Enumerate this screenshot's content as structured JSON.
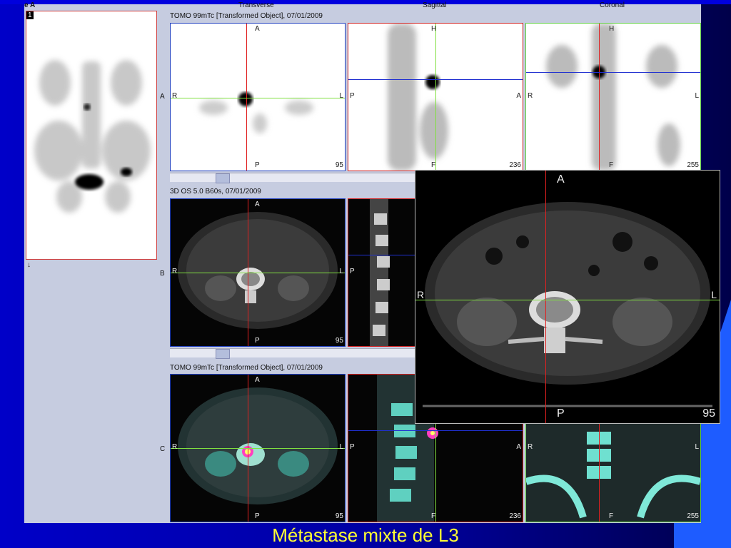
{
  "window": {
    "title": "e A"
  },
  "mip": {
    "number": "1",
    "bottom_mark": "↓"
  },
  "rows": {
    "A": {
      "label": "A",
      "title": "TOMO 99mTc [Transformed Object], 07/01/2009",
      "transverse": {
        "top": "A",
        "left": "R",
        "right": "L",
        "bottom": "P",
        "slice": "95"
      },
      "sagittal": {
        "top": "H",
        "left": "P",
        "right": "A",
        "bottom": "F",
        "slice": "236"
      },
      "coronal": {
        "top": "H",
        "left": "R",
        "right": "L",
        "bottom": "F",
        "slice": "255"
      }
    },
    "B": {
      "label": "B",
      "title": "3D  OS  5.0  B60s, 07/01/2009",
      "transverse": {
        "top": "A",
        "left": "R",
        "right": "L",
        "bottom": "P",
        "slice": "95"
      },
      "sagittal": {
        "left": "P"
      }
    },
    "C": {
      "label": "C",
      "title": "TOMO 99mTc [Transformed Object], 07/01/2009",
      "transverse": {
        "top": "A",
        "left": "R",
        "right": "L",
        "bottom": "P",
        "slice": "95"
      },
      "sagittal": {
        "left": "P",
        "right": "A",
        "bottom": "F",
        "slice": "236"
      },
      "coronal": {
        "left": "R",
        "right": "L",
        "bottom": "F",
        "slice": "255"
      }
    }
  },
  "columns": {
    "transverse": "Transverse",
    "sagittal": "Sagittal",
    "coronal": "Coronal"
  },
  "zoom": {
    "top": "A",
    "left": "R",
    "right": "L",
    "bottom": "P",
    "slice": "95"
  },
  "caption": "Métastase mixte de L3",
  "colors": {
    "crosshair_red": "#e02020",
    "crosshair_green": "#80e040",
    "crosshair_blue": "#2030d0",
    "caption": "#ffff33",
    "accent_blue": "#1e5cff"
  }
}
